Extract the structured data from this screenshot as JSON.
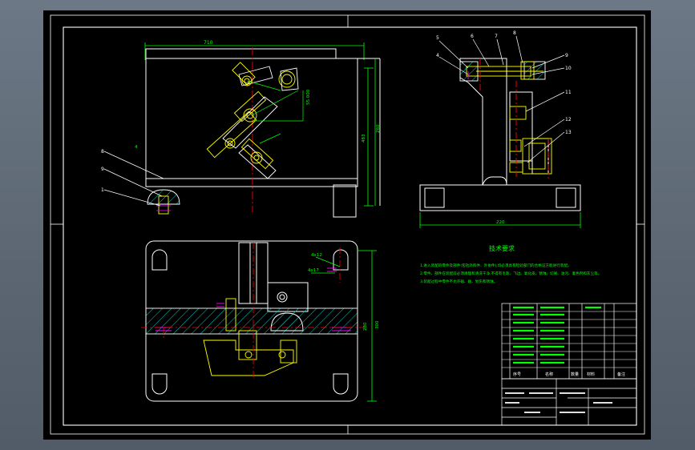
{
  "drawing": {
    "dims": {
      "top_width": "710",
      "right_height_outer": "483",
      "right_height_inner": "260",
      "center_offset": "4",
      "diag_dim": "55.000",
      "side_width": "220",
      "plan_right_height": "300",
      "plan_inner_height": "280",
      "hole_note_top": "4x12",
      "hole_note_mid": "4x17"
    },
    "balloons": {
      "front": [
        "8",
        "9",
        "1"
      ],
      "side": [
        "5",
        "4",
        "6",
        "7",
        "8",
        "9",
        "10",
        "11",
        "12",
        "13"
      ]
    }
  },
  "tech": {
    "title": "技术要求",
    "lines": [
      "1.进入装配的零件及部件(包括外购件、外协件),均必须具有检验部门的合格证方能进行装配。",
      "2.零件、部件在装配前必须清理和清洗干净,不得有毛刺、飞边、氧化皮、锈蚀、切屑、油污、着色剂和灰尘等。",
      "3.装配过程中零件不允许磕、碰、划伤和锈蚀。"
    ]
  },
  "bom": {
    "footer": [
      "序号",
      "名称",
      "数量",
      "材料",
      "备注"
    ]
  },
  "colors": {
    "outline": "#ffffff",
    "dim": "#00ff00",
    "center": "#ff0000",
    "part": "#ffff00",
    "text": "#00ff00",
    "accent": "#ff00ff",
    "hatch": "#00c8c8"
  }
}
